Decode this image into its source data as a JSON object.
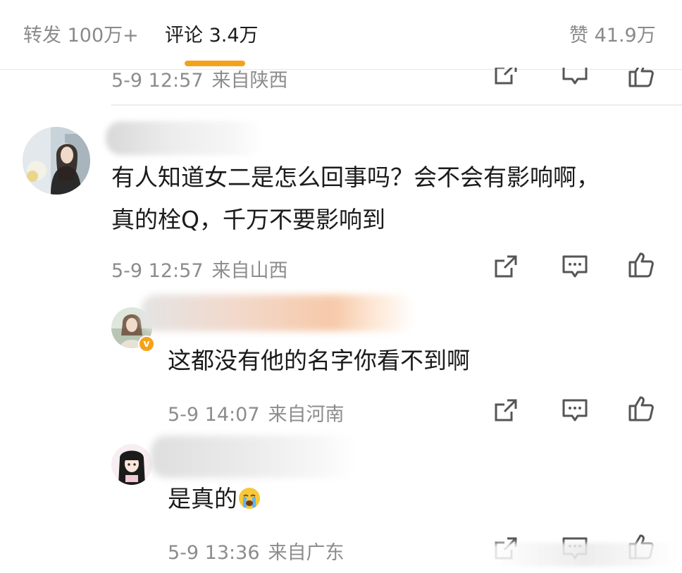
{
  "tabs": {
    "repost": "转发 100万+",
    "comments": "评论 3.4万",
    "likes": "赞 41.9万"
  },
  "top_comment": {
    "date": "5-9 12:57",
    "location": "来自陕西"
  },
  "comment": {
    "text_line1": "有人知道女二是怎么回事吗？会不会有影响啊，",
    "text_line2": "真的栓Q，千万不要影响到",
    "date": "5-9 12:57",
    "location": "来自山西"
  },
  "replies": [
    {
      "text": "这都没有他的名字你看不到啊",
      "date": "5-9 14:07",
      "location": "来自河南",
      "verified": true
    },
    {
      "text": "是真的",
      "emoji": "crying-face-emoji",
      "date": "5-9 13:36",
      "location": "来自广东"
    }
  ],
  "icons": [
    "share-icon",
    "comment-icon",
    "like-icon"
  ],
  "colors": {
    "accent": "#f5a21a",
    "meta_text": "#8c8c8c",
    "body_text": "#1b1b1b",
    "icon": "#555555"
  }
}
